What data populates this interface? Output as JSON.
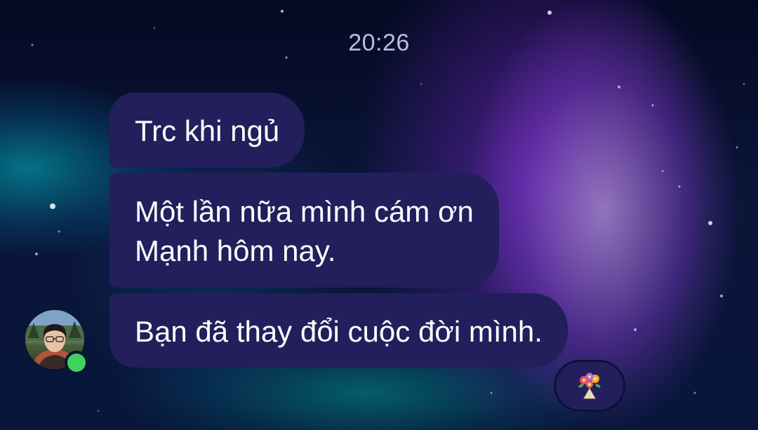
{
  "chat": {
    "timestamp": "20:26",
    "messages": [
      {
        "line1": "Trc khi ngủ"
      },
      {
        "line1": "Một lần nữa mình cám ơn",
        "line2": "Mạnh hôm nay."
      },
      {
        "line1": "Bạn đã thay đổi cuộc đời mình."
      }
    ],
    "reaction": {
      "icon": "bouquet-icon",
      "emoji": "💐"
    },
    "sender": {
      "avatar_icon": "avatar-photo",
      "online": true,
      "status_color": "#3fd35a"
    }
  },
  "theme": {
    "bubble_color": "#221f5c",
    "timestamp_color": "#b9bfd6",
    "text_color": "#ffffff"
  }
}
